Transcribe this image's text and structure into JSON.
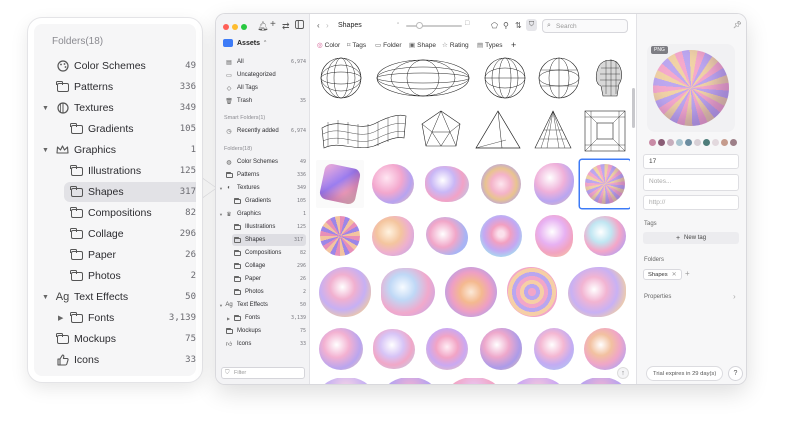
{
  "zoom": {
    "title": "Folders(18)",
    "items": [
      {
        "label": "Color Schemes",
        "count": "49",
        "icon": "palette-icon"
      },
      {
        "label": "Patterns",
        "count": "336",
        "icon": "folder-icon"
      },
      {
        "label": "Textures",
        "count": "349",
        "icon": "texture-icon"
      },
      {
        "label": "Gradients",
        "count": "105",
        "icon": "folder-icon"
      },
      {
        "label": "Graphics",
        "count": "1",
        "icon": "crown-icon"
      },
      {
        "label": "Illustrations",
        "count": "125",
        "icon": "folder-icon"
      },
      {
        "label": "Shapes",
        "count": "317",
        "icon": "folder-icon"
      },
      {
        "label": "Compositions",
        "count": "82",
        "icon": "folder-icon"
      },
      {
        "label": "Collage",
        "count": "296",
        "icon": "folder-icon"
      },
      {
        "label": "Paper",
        "count": "26",
        "icon": "folder-icon"
      },
      {
        "label": "Photos",
        "count": "2",
        "icon": "folder-icon"
      },
      {
        "label": "Text Effects",
        "count": "50",
        "icon": "text-effects-icon"
      },
      {
        "label": "Fonts",
        "count": "3,139",
        "icon": "folder-icon"
      },
      {
        "label": "Mockups",
        "count": "75",
        "icon": "folder-icon"
      },
      {
        "label": "Icons",
        "count": "33",
        "icon": "thumbs-up-icon"
      }
    ]
  },
  "sidebar": {
    "library": "Assets",
    "main_items": [
      {
        "label": "All",
        "count": "6,974"
      },
      {
        "label": "Uncategorized",
        "count": ""
      },
      {
        "label": "All Tags",
        "count": ""
      },
      {
        "label": "Trash",
        "count": "35"
      }
    ],
    "smart_title": "Smart Folders(1)",
    "smart_items": [
      {
        "label": "Recently added",
        "count": "6,974"
      }
    ],
    "folders_title": "Folders(18)",
    "folders": [
      {
        "label": "Color Schemes",
        "count": "49"
      },
      {
        "label": "Patterns",
        "count": "336"
      },
      {
        "label": "Textures",
        "count": "349"
      },
      {
        "label": "Gradients",
        "count": "105"
      },
      {
        "label": "Graphics",
        "count": "1"
      },
      {
        "label": "Illustrations",
        "count": "125"
      },
      {
        "label": "Shapes",
        "count": "317"
      },
      {
        "label": "Compositions",
        "count": "82"
      },
      {
        "label": "Collage",
        "count": "296"
      },
      {
        "label": "Paper",
        "count": "26"
      },
      {
        "label": "Photos",
        "count": "2"
      },
      {
        "label": "Text Effects",
        "count": "50"
      },
      {
        "label": "Fonts",
        "count": "3,139"
      },
      {
        "label": "Mockups",
        "count": "75"
      },
      {
        "label": "Icons",
        "count": "33"
      }
    ],
    "filter_placeholder": "Filter"
  },
  "toolbar": {
    "title": "Shapes",
    "search_placeholder": "Search",
    "filters": [
      "Color",
      "Tags",
      "Folder",
      "Shape",
      "Rating",
      "Types"
    ],
    "add": "+"
  },
  "inspector": {
    "badge": "PNG",
    "name_value": "17",
    "notes_placeholder": "Notes...",
    "url_placeholder": "http://",
    "tags_label": "Tags",
    "new_tag": "New tag",
    "folders_label": "Folders",
    "folder_tag": "Shapes",
    "properties_label": "Properties",
    "trial": "Trial expires in 29 day(s)",
    "help": "?",
    "swatch_colors": [
      "#c98ba6",
      "#8a5c75",
      "#c7aebd",
      "#a9c4cf",
      "#6c8da0",
      "#d8d0d6",
      "#4e7d7a",
      "#e3d9de",
      "#c59b8d",
      "#9d7f88"
    ]
  },
  "colors": {
    "accent": "#3d7bf7",
    "close": "#ff5f57",
    "minimize": "#febc2e",
    "zoom": "#28c840"
  }
}
